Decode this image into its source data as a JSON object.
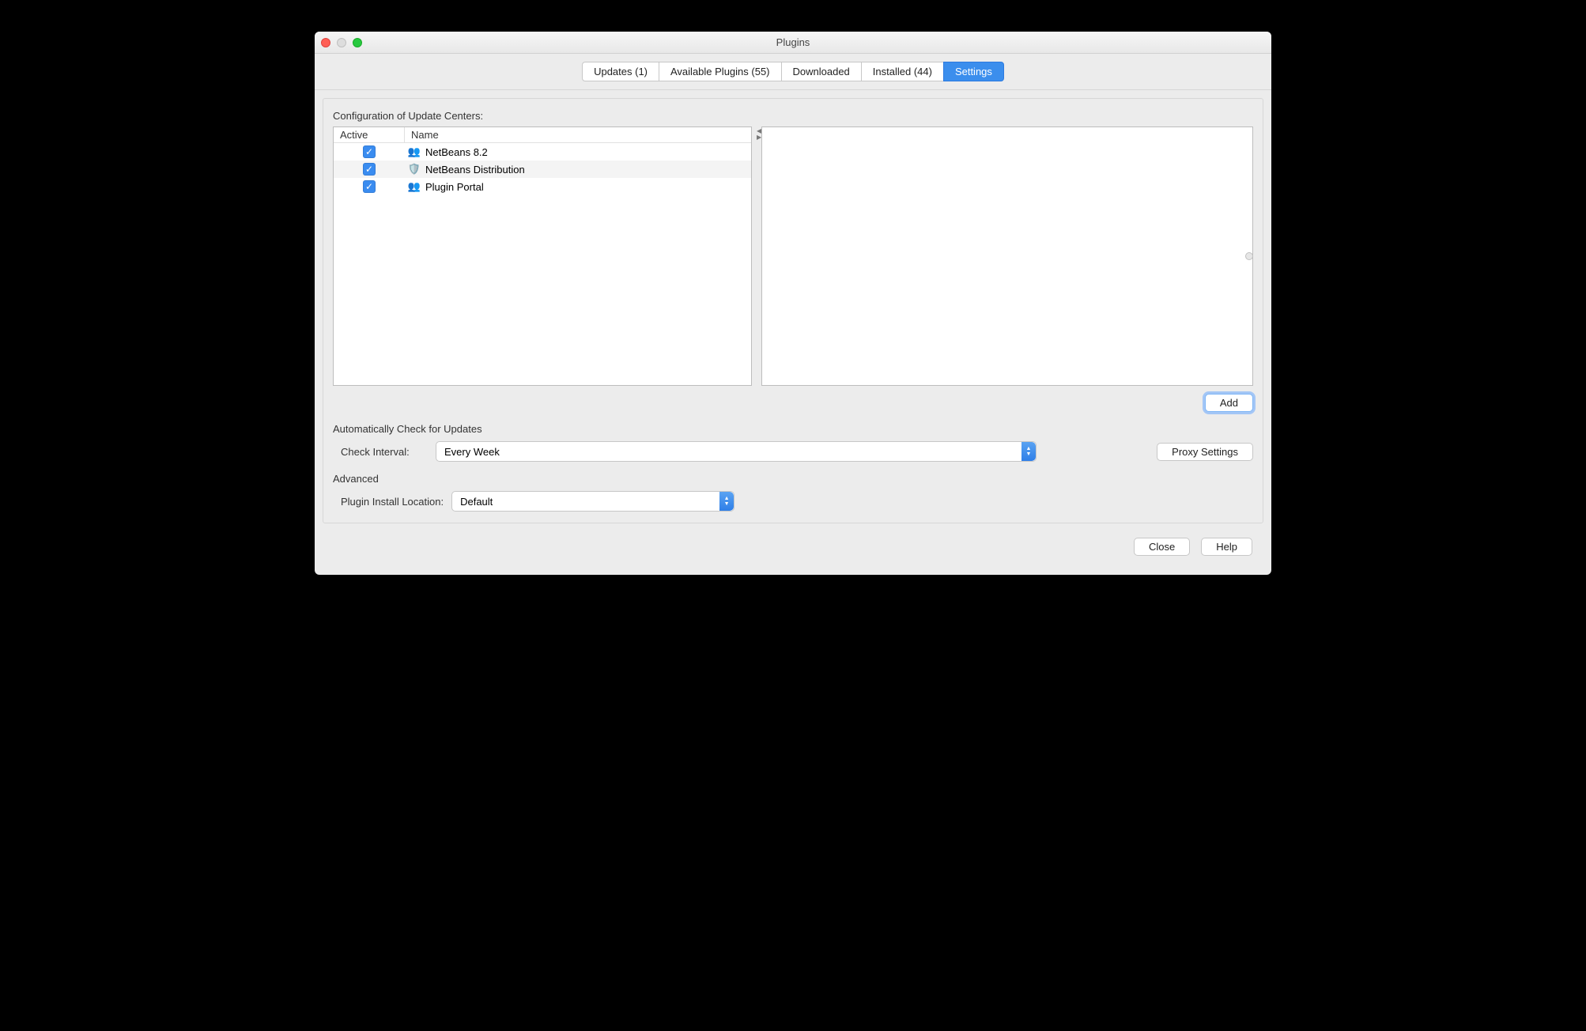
{
  "window_title": "Plugins",
  "tabs": [
    {
      "label": "Updates (1)"
    },
    {
      "label": "Available Plugins (55)"
    },
    {
      "label": "Downloaded"
    },
    {
      "label": "Installed (44)"
    },
    {
      "label": "Settings",
      "active": true
    }
  ],
  "section_label": "Configuration of Update Centers:",
  "columns": {
    "active": "Active",
    "name": "Name"
  },
  "update_centers": [
    {
      "active": true,
      "icon": "people",
      "name": "NetBeans 8.2"
    },
    {
      "active": true,
      "icon": "box",
      "name": "NetBeans Distribution"
    },
    {
      "active": true,
      "icon": "people",
      "name": "Plugin Portal"
    }
  ],
  "add_button": "Add",
  "auto_check_label": "Automatically Check for Updates",
  "check_interval_label": "Check Interval:",
  "check_interval_value": "Every Week",
  "proxy_button": "Proxy Settings",
  "advanced_label": "Advanced",
  "install_location_label": "Plugin Install Location:",
  "install_location_value": "Default",
  "close_button": "Close",
  "help_button": "Help"
}
